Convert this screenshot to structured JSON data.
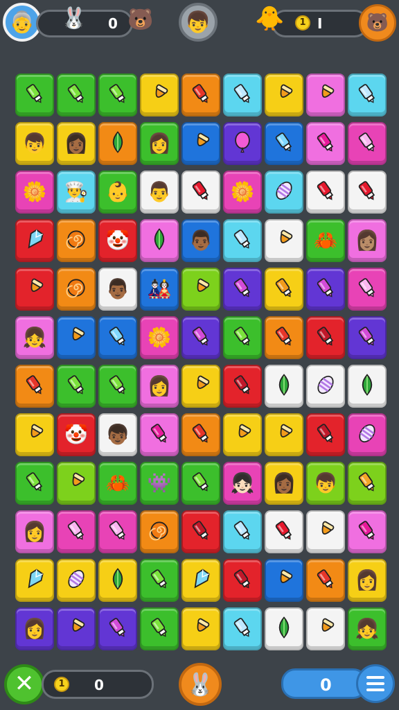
{
  "top": {
    "player_avatar": "👵",
    "rabbit_icon": "🐰",
    "bear_icon": "🐻",
    "left_count": "0",
    "center_avatar": "👦",
    "right_character": "🐥",
    "coin_label": "1",
    "right_count": "I",
    "corner_icon": "🐻"
  },
  "bottom": {
    "close_label": "✕",
    "coin_label": "1",
    "left_count": "0",
    "center_icon": "🐰",
    "right_count": "0"
  },
  "colors": {
    "green": "#3cbf2c",
    "lime": "#7dd11c",
    "yellow": "#f6cf16",
    "orange": "#f28a15",
    "red": "#e3232b",
    "cyan": "#5cd6ef",
    "blue": "#1f74dc",
    "purple": "#6236d4",
    "pink": "#f06fe0",
    "magenta": "#e843b6",
    "white": "#f4f4f4"
  },
  "board": {
    "columns": 9,
    "rows": [
      [
        [
          "green",
          "marker-icon"
        ],
        [
          "green",
          "marker-icon"
        ],
        [
          "green",
          "marker-icon"
        ],
        [
          "yellow",
          "cone-icon"
        ],
        [
          "orange",
          "marker-icon"
        ],
        [
          "cyan",
          "marker-icon"
        ],
        [
          "yellow",
          "cone-icon"
        ],
        [
          "pink",
          "cone-icon"
        ],
        [
          "cyan",
          "marker-icon"
        ]
      ],
      [
        [
          "yellow",
          "👦"
        ],
        [
          "yellow",
          "👩🏾"
        ],
        [
          "orange",
          "leaf-icon"
        ],
        [
          "green",
          "👩"
        ],
        [
          "blue",
          "cone-icon"
        ],
        [
          "purple",
          "balloon-icon"
        ],
        [
          "blue",
          "marker-icon"
        ],
        [
          "pink",
          "marker-icon"
        ],
        [
          "magenta",
          "marker-icon"
        ]
      ],
      [
        [
          "magenta",
          "🌼"
        ],
        [
          "cyan",
          "👨‍🍳"
        ],
        [
          "green",
          "👶"
        ],
        [
          "white",
          "👨"
        ],
        [
          "white",
          "marker-icon"
        ],
        [
          "magenta",
          "🌼"
        ],
        [
          "cyan",
          "egg-icon"
        ],
        [
          "white",
          "marker-icon"
        ],
        [
          "white",
          "marker-icon"
        ]
      ],
      [
        [
          "red",
          "gem-icon"
        ],
        [
          "orange",
          "spiral-icon"
        ],
        [
          "red",
          "🤡"
        ],
        [
          "pink",
          "leaf-icon"
        ],
        [
          "blue",
          "👨🏾"
        ],
        [
          "cyan",
          "marker-icon"
        ],
        [
          "white",
          "cone-icon"
        ],
        [
          "green",
          "🦀"
        ],
        [
          "pink",
          "👩🏽"
        ]
      ],
      [
        [
          "red",
          "cone-icon"
        ],
        [
          "orange",
          "spiral-icon"
        ],
        [
          "white",
          "👨🏾"
        ],
        [
          "blue",
          "🎎"
        ],
        [
          "lime",
          "cone-icon"
        ],
        [
          "purple",
          "marker-icon"
        ],
        [
          "yellow",
          "marker-icon"
        ],
        [
          "purple",
          "marker-icon"
        ],
        [
          "magenta",
          "marker-icon"
        ]
      ],
      [
        [
          "pink",
          "👧"
        ],
        [
          "blue",
          "cone-icon"
        ],
        [
          "blue",
          "marker-icon"
        ],
        [
          "magenta",
          "🌼"
        ],
        [
          "purple",
          "marker-icon"
        ],
        [
          "green",
          "marker-icon"
        ],
        [
          "orange",
          "marker-icon"
        ],
        [
          "red",
          "marker-icon"
        ],
        [
          "purple",
          "marker-icon"
        ]
      ],
      [
        [
          "orange",
          "marker-icon"
        ],
        [
          "green",
          "marker-icon"
        ],
        [
          "green",
          "marker-icon"
        ],
        [
          "pink",
          "👩"
        ],
        [
          "yellow",
          "cone-icon"
        ],
        [
          "red",
          "marker-icon"
        ],
        [
          "white",
          "leaf-icon"
        ],
        [
          "white",
          "egg-icon"
        ],
        [
          "white",
          "leaf-icon"
        ]
      ],
      [
        [
          "yellow",
          "cone-icon"
        ],
        [
          "red",
          "🤡"
        ],
        [
          "white",
          "👦🏾"
        ],
        [
          "pink",
          "marker-icon"
        ],
        [
          "orange",
          "marker-icon"
        ],
        [
          "yellow",
          "cone-icon"
        ],
        [
          "yellow",
          "cone-icon"
        ],
        [
          "red",
          "marker-icon"
        ],
        [
          "magenta",
          "egg-icon"
        ]
      ],
      [
        [
          "green",
          "marker-icon"
        ],
        [
          "lime",
          "cone-icon"
        ],
        [
          "green",
          "🦀"
        ],
        [
          "green",
          "👾"
        ],
        [
          "green",
          "marker-icon"
        ],
        [
          "magenta",
          "👧🏻"
        ],
        [
          "yellow",
          "👩🏾"
        ],
        [
          "lime",
          "👦"
        ],
        [
          "lime",
          "marker-icon"
        ]
      ],
      [
        [
          "pink",
          "👩"
        ],
        [
          "magenta",
          "marker-icon"
        ],
        [
          "magenta",
          "marker-icon"
        ],
        [
          "orange",
          "spiral-icon"
        ],
        [
          "red",
          "marker-icon"
        ],
        [
          "cyan",
          "marker-icon"
        ],
        [
          "white",
          "marker-icon"
        ],
        [
          "white",
          "cone-icon"
        ],
        [
          "pink",
          "marker-icon"
        ]
      ],
      [
        [
          "yellow",
          "gem-icon"
        ],
        [
          "yellow",
          "egg-icon"
        ],
        [
          "yellow",
          "leaf-icon"
        ],
        [
          "green",
          "marker-icon"
        ],
        [
          "yellow",
          "gem-icon"
        ],
        [
          "red",
          "marker-icon"
        ],
        [
          "blue",
          "cone-icon"
        ],
        [
          "orange",
          "marker-icon"
        ],
        [
          "yellow",
          "👩"
        ]
      ],
      [
        [
          "purple",
          "👩"
        ],
        [
          "purple",
          "cone-icon"
        ],
        [
          "purple",
          "marker-icon"
        ],
        [
          "green",
          "marker-icon"
        ],
        [
          "yellow",
          "cone-icon"
        ],
        [
          "cyan",
          "marker-icon"
        ],
        [
          "white",
          "leaf-icon"
        ],
        [
          "white",
          "cone-icon"
        ],
        [
          "green",
          "👧"
        ]
      ]
    ]
  }
}
